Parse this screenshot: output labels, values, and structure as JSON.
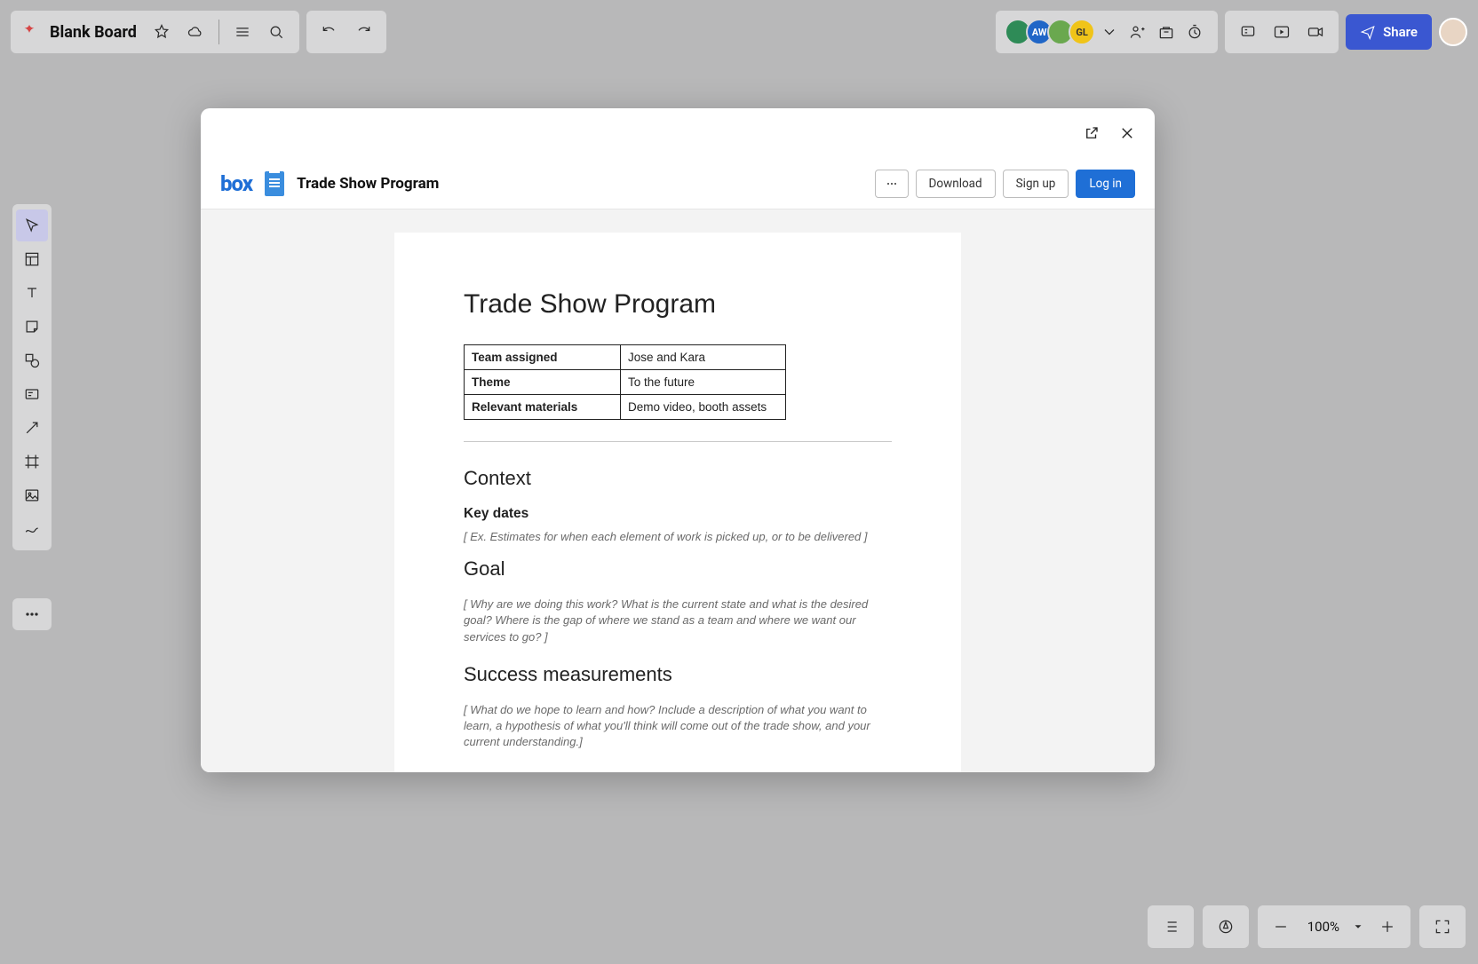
{
  "board": {
    "title": "Blank Board"
  },
  "share": {
    "label": "Share"
  },
  "avatars": {
    "a2": "AW",
    "a4": "GL"
  },
  "zoom": {
    "value": "100%"
  },
  "modal": {
    "box_logo": "box",
    "doc_title": "Trade Show Program",
    "actions": {
      "download": "Download",
      "signup": "Sign up",
      "login": "Log in"
    }
  },
  "document": {
    "h1": "Trade Show Program",
    "table": {
      "row1": {
        "k": "Team assigned",
        "v": "Jose and Kara"
      },
      "row2": {
        "k": "Theme",
        "v": "To the future"
      },
      "row3": {
        "k": "Relevant materials",
        "v": "Demo video, booth assets"
      }
    },
    "h2_context": "Context",
    "h3_keydates": "Key dates",
    "hint_keydates": "[ Ex. Estimates for when each element of work is picked up, or to be delivered ]",
    "h2_goal": "Goal",
    "hint_goal": "[ Why are we doing this work? What is the current state and what is the desired goal? Where is the gap of where we stand as a team and where we want our services to go?  ]",
    "h2_success": "Success measurements",
    "hint_success": "[ What do we hope to learn and how? Include a description of what you want to learn, a hypothesis of what you'll think will come out of the trade show, and your current understanding.]"
  }
}
